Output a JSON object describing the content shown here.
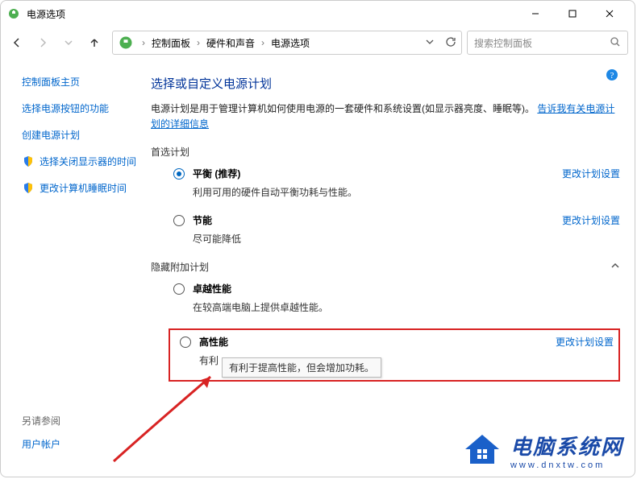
{
  "window": {
    "title": "电源选项"
  },
  "breadcrumb": {
    "control_panel": "控制面板",
    "hw_sound": "硬件和声音",
    "power": "电源选项"
  },
  "search": {
    "placeholder": "搜索控制面板"
  },
  "sidebar": {
    "home": "控制面板主页",
    "items": [
      "选择电源按钮的功能",
      "创建电源计划",
      "选择关闭显示器的时间",
      "更改计算机睡眠时间"
    ],
    "see_also_label": "另请参阅",
    "see_also_link": "用户帐户"
  },
  "main": {
    "title": "选择或自定义电源计划",
    "desc_prefix": "电源计划是用于管理计算机如何使用电源的一套硬件和系统设置(如显示器亮度、睡眠等)。",
    "desc_link": "告诉我有关电源计划的详细信息",
    "preferred_label": "首选计划",
    "hidden_label": "隐藏附加计划",
    "edit_label": "更改计划设置",
    "plans": {
      "balanced": {
        "name": "平衡 (推荐)",
        "desc": "利用可用的硬件自动平衡功耗与性能。"
      },
      "saver": {
        "name": "节能",
        "desc": "尽可能降低"
      },
      "ultimate": {
        "name": "卓越性能",
        "desc": "在较高端电脑上提供卓越性能。"
      },
      "high": {
        "name": "高性能",
        "desc_hidden_prefix": "有利",
        "tooltip": "有利于提高性能，但会增加功耗。"
      }
    }
  },
  "watermark": {
    "title": "电脑系统网",
    "subtitle": "www.dnxtw.com"
  }
}
